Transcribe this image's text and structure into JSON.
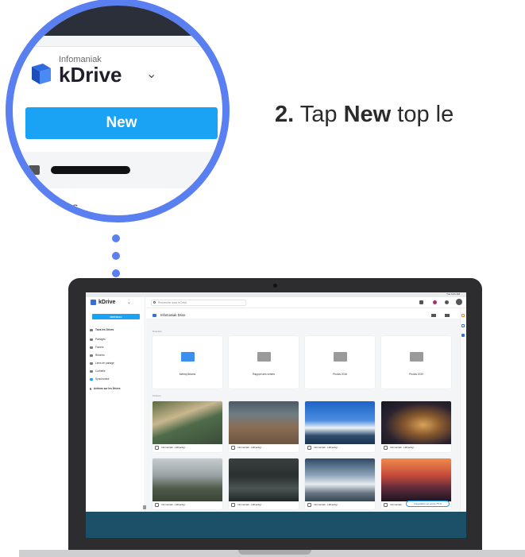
{
  "instruction": {
    "step_number": "2.",
    "prefix": "Tap",
    "keyword": "New",
    "suffix": "top le"
  },
  "zoom": {
    "brand_company": "Infomaniak",
    "brand_product": "kDrive",
    "new_button": "New",
    "partial_item": "tages",
    "accent_color": "#5a7ff1",
    "button_color": "#1aa3f5"
  },
  "screen": {
    "menubar_status": "Tue 9:41 AM",
    "sidebar": {
      "brand": "kDrive",
      "new_button": "NOUVEAU",
      "items": [
        {
          "label": "Tous les Drives",
          "icon": "drive-icon"
        },
        {
          "label": "Partagés",
          "icon": "share-icon"
        },
        {
          "label": "Favoris",
          "icon": "star-icon"
        },
        {
          "label": "Récents",
          "icon": "clock-icon"
        },
        {
          "label": "Liens de partage",
          "icon": "link-icon"
        },
        {
          "label": "Corbeille",
          "icon": "trash-icon"
        },
        {
          "label": "Synchronisé",
          "icon": "sync-icon"
        },
        {
          "label": "Actions sur les Drives",
          "icon": "chevron-icon"
        }
      ]
    },
    "search_placeholder": "Rechercher dans le Drive",
    "breadcrumb": "Infomaniak Drive",
    "sections": {
      "folders": "Dossiers",
      "files": "Fichiers"
    },
    "folders": [
      {
        "label": "Mémoj Beams",
        "color": "#3b8ff0"
      },
      {
        "label": "Rapport des ventes",
        "color": "#9a9a9a"
      },
      {
        "label": "Photos 2016",
        "color": "#9a9a9a"
      },
      {
        "label": "Photos 2019",
        "color": "#9a9a9a"
      }
    ],
    "photos": [
      {
        "label": "Infomaniak - Hdbackgr..."
      },
      {
        "label": "Infomaniak - Hdbackgr..."
      },
      {
        "label": "Infomaniak - Hdbackgr..."
      },
      {
        "label": "Infomaniak - Hdbackgr..."
      },
      {
        "label": "Infomaniak - Hdbackgr..."
      },
      {
        "label": "Infomaniak - Hdbackgr..."
      },
      {
        "label": "Infomaniak - Hdbackgr..."
      },
      {
        "label": "Infomaniak -"
      }
    ],
    "upload_status": "Importation en cours 75 %"
  }
}
